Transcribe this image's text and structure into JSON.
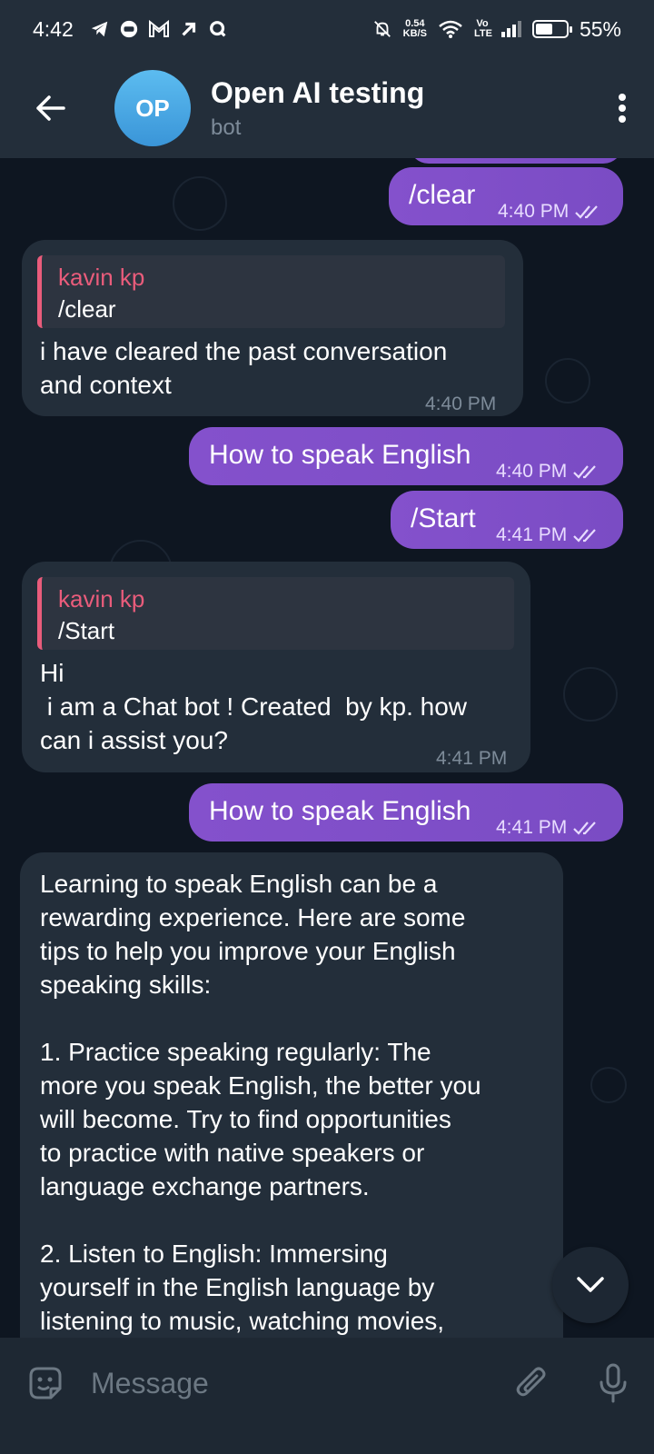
{
  "status_bar": {
    "time": "4:42",
    "net_speed_value": "0.54",
    "net_speed_unit": "KB/S",
    "volte": "Vo LTE",
    "battery": "55%",
    "battery_level": 0.55
  },
  "header": {
    "avatar_initials": "OP",
    "title": "Open AI testing",
    "subtitle": "bot"
  },
  "messages": [
    {
      "type": "out",
      "text": "/clear",
      "time": "4:40 PM"
    },
    {
      "type": "in",
      "reply_name": "kavin kp",
      "reply_text": "/clear",
      "text": "i have cleared the past conversation\nand context",
      "time": "4:40 PM"
    },
    {
      "type": "out",
      "text": "How to speak English",
      "time": "4:40 PM"
    },
    {
      "type": "out",
      "text": "/Start",
      "time": "4:41 PM"
    },
    {
      "type": "in",
      "reply_name": "kavin kp",
      "reply_text": "/Start",
      "text": "Hi\n i am a Chat bot ! Created  by kp. how\ncan i assist you?",
      "time": "4:41 PM"
    },
    {
      "type": "out",
      "text": "How to speak English",
      "time": "4:41 PM"
    },
    {
      "type": "in",
      "text": "Learning to speak English can be a\nrewarding experience. Here are some\ntips to help you improve your English\nspeaking skills:\n\n1. Practice speaking regularly: The\nmore you speak English, the better you\nwill become. Try to find opportunities\nto practice with native speakers or\nlanguage exchange partners.\n\n2. Listen to English: Immersing\nyourself in the English language by\nlistening to music, watching movies,"
    }
  ],
  "input": {
    "placeholder": "Message"
  },
  "colors": {
    "header_bg": "#232e3a",
    "chat_bg": "#0e1621",
    "outgoing_bubble": "#7e4ec8",
    "incoming_bubble": "#232e3a",
    "reply_accent": "#e95c7b",
    "avatar": "#4aa8e3"
  }
}
